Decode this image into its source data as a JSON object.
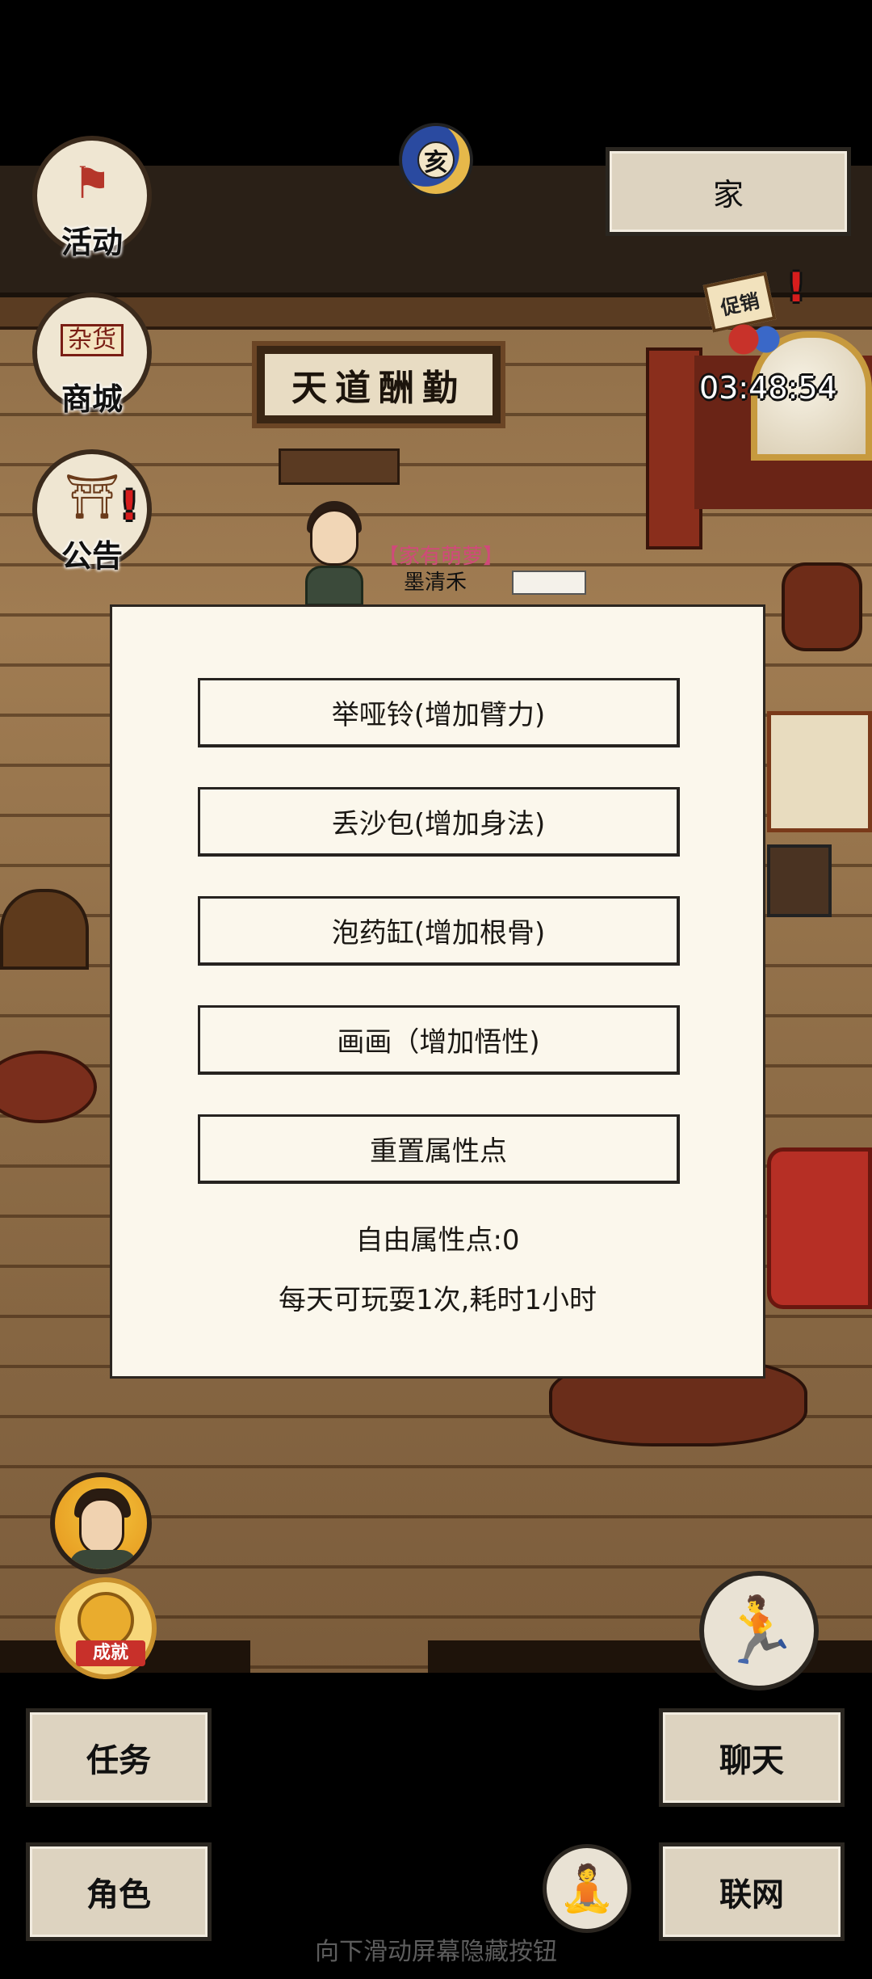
{
  "hud": {
    "activity_label": "活动",
    "shop_label": "商城",
    "shop_sign": "杂货",
    "notice_label": "公告",
    "time_icon_char": "亥",
    "home_button": "家",
    "promo_sign": "促销",
    "promo_timer": "03:48:54"
  },
  "scene": {
    "plaque": "天道酬勤",
    "player_guild": "【家有萌萝】",
    "player_name": "墨清禾"
  },
  "modal": {
    "options": [
      "举哑铃(增加臂力)",
      "丢沙包(增加身法)",
      "泡药缸(增加根骨)",
      "画画（增加悟性)",
      "重置属性点"
    ],
    "free_points": "自由属性点:0",
    "rule": "每天可玩耍1次,耗时1小时"
  },
  "bottom": {
    "achievement_label": "成就",
    "task_button": "任务",
    "chat_button": "聊天",
    "role_button": "角色",
    "network_button": "联网",
    "swipe_hint": "向下滑动屏幕隐藏按钮"
  },
  "icons": {
    "activity": "flag-icon",
    "shop": "shop-icon",
    "notice": "notice-board-icon",
    "time": "moon-time-icon",
    "run": "running-man-icon",
    "meditate": "meditation-icon",
    "achievement": "achievement-medal-icon"
  },
  "colors": {
    "alert": "#d51d1d",
    "guild_name": "#d04a7a",
    "modal_bg": "#fbf7ec",
    "button_bg": "#ddd3c0"
  }
}
